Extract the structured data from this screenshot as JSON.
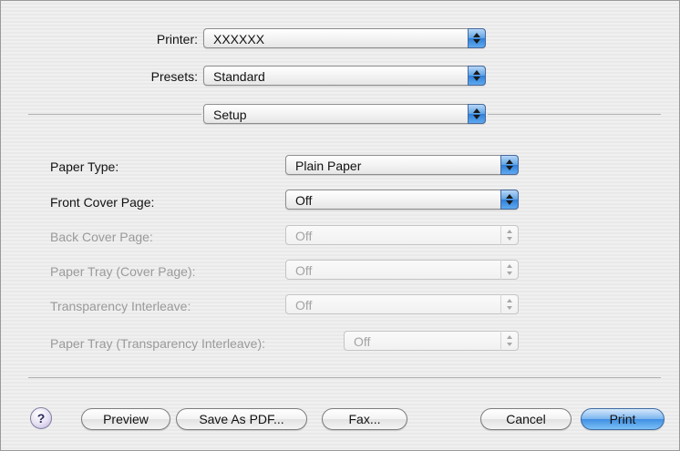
{
  "top": {
    "printer_label": "Printer:",
    "printer_value": "XXXXXX",
    "presets_label": "Presets:",
    "presets_value": "Standard",
    "panel_value": "Setup"
  },
  "options": [
    {
      "label": "Paper Type:",
      "value": "Plain Paper",
      "enabled": true
    },
    {
      "label": "Front Cover Page:",
      "value": "Off",
      "enabled": true
    },
    {
      "label": "Back Cover Page:",
      "value": "Off",
      "enabled": false
    },
    {
      "label": "Paper Tray (Cover Page):",
      "value": "Off",
      "enabled": false
    },
    {
      "label": "Transparency Interleave:",
      "value": "Off",
      "enabled": false
    },
    {
      "label": "Paper Tray (Transparency Interleave):",
      "value": "Off",
      "enabled": false
    }
  ],
  "buttons": {
    "help": "?",
    "preview": "Preview",
    "save_pdf": "Save As PDF...",
    "fax": "Fax...",
    "cancel": "Cancel",
    "print": "Print"
  },
  "icons": {
    "popup_arrows": "updown-arrows-icon",
    "help": "help-icon"
  },
  "colors": {
    "accent_blue": "#4a8fe0",
    "disabled_text": "#9a9a9a"
  }
}
